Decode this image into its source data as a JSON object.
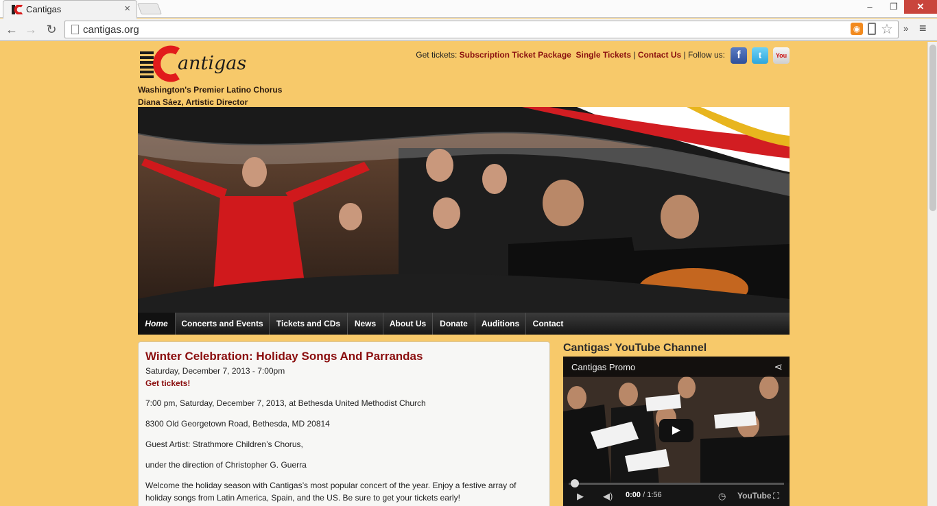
{
  "browser": {
    "tab_title": "Cantigas",
    "tab_close": "×",
    "url": "cantigas.org",
    "win_min": "–",
    "win_max": "❐",
    "win_close": "✕"
  },
  "site": {
    "tagline_1": "Washington's Premier Latino Chorus",
    "tagline_2": "Diana Sáez, Artistic Director",
    "get_tickets_label": "Get tickets:",
    "subscription_link": "Subscription Ticket Package",
    "single_link": "Single Tickets",
    "separator_1": "|",
    "contact_link": "Contact Us",
    "separator_2": "|",
    "follow_label": "Follow us:",
    "logo_text": "Cantigas",
    "brand_color": "#8a0d0d"
  },
  "nav": {
    "items": [
      {
        "label": "Home"
      },
      {
        "label": "Concerts and Events"
      },
      {
        "label": "Tickets and CDs"
      },
      {
        "label": "News"
      },
      {
        "label": "About Us"
      },
      {
        "label": "Donate"
      },
      {
        "label": "Auditions"
      },
      {
        "label": "Contact"
      }
    ]
  },
  "event": {
    "title": "Winter Celebration: Holiday Songs And Parrandas",
    "date": "Saturday, December 7, 2013 - 7:00pm",
    "tickets_link": "Get tickets!",
    "paragraphs": [
      "7:00 pm, Saturday, December 7, 2013, at Bethesda United Methodist Church",
      "8300 Old Georgetown Road, Bethesda, MD  20814",
      "Guest Artist:  Strathmore Children’s Chorus,",
      "under the direction of Christopher G. Guerra",
      "Welcome the holiday season with Cantigas’s most popular concert of the year.  Enjoy a festive array of holiday songs from Latin America, Spain, and the US. Be sure to get your tickets early!"
    ]
  },
  "youtube": {
    "heading": "Cantigas' YouTube Channel",
    "video_title": "Cantigas Promo",
    "time_current": "0:00",
    "time_total": " / 1:56",
    "logo": "YouTube"
  }
}
